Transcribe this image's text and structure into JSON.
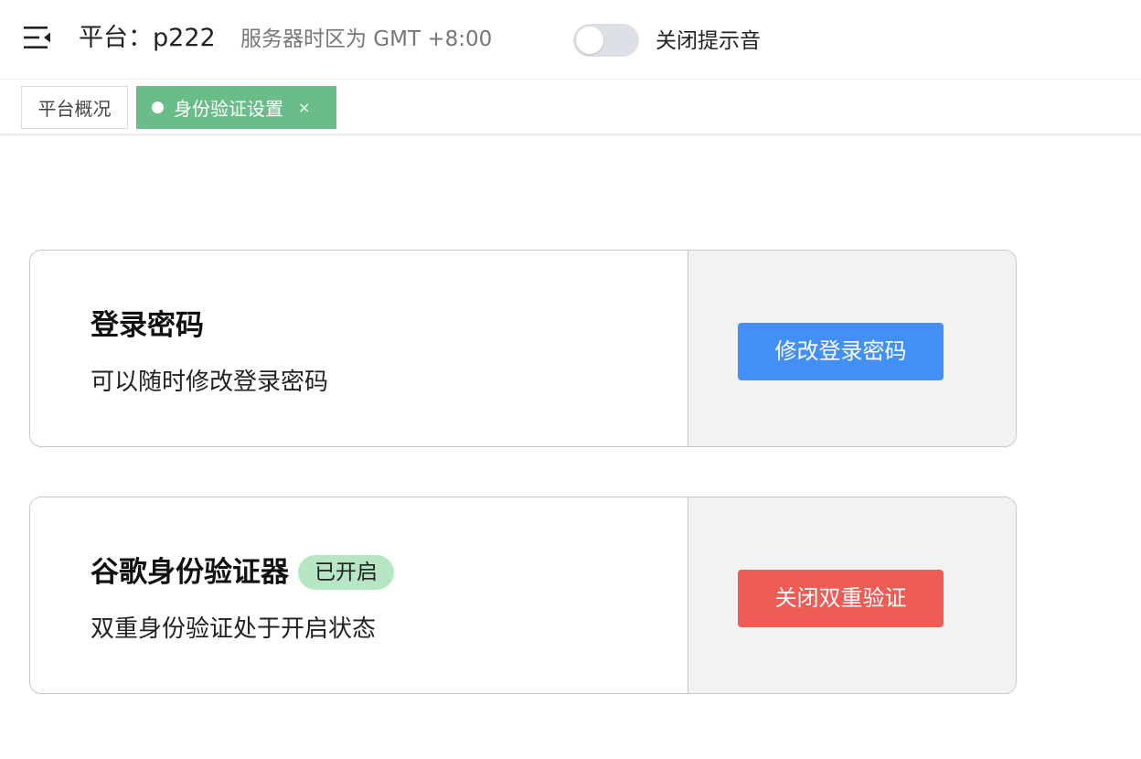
{
  "header": {
    "platform_title": "平台：p222",
    "timezone_text": "服务器时区为 GMT +8:00",
    "sound_toggle_label": "关闭提示音",
    "sound_toggle_on": false
  },
  "tabs": {
    "overview_label": "平台概况",
    "active_label": "身份验证设置",
    "close_symbol": "×",
    "active_color": "#6abd88"
  },
  "login_password": {
    "title": "登录密码",
    "description": "可以随时修改登录密码",
    "button_label": "修改登录密码",
    "button_color": "#428ff7"
  },
  "google_auth": {
    "title": "谷歌身份验证器",
    "status_badge": "已开启",
    "description": "双重身份验证处于开启状态",
    "button_label": "关闭双重验证",
    "button_color": "#ef5b55"
  },
  "icons": {
    "menu": "menu-fold-icon",
    "tab_dot": "dot-icon",
    "tab_close": "close-icon"
  }
}
